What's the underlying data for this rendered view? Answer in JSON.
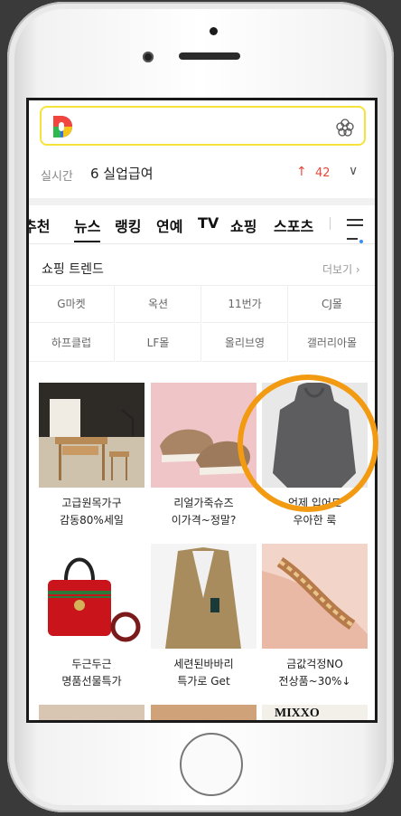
{
  "search": {
    "placeholder": ""
  },
  "realtime": {
    "label": "실시간",
    "keyword": "6 실업급여",
    "arrow": "↑",
    "count": "42",
    "chevron": "∨"
  },
  "tabs": [
    {
      "label": "추천"
    },
    {
      "label": "뉴스"
    },
    {
      "label": "랭킹"
    },
    {
      "label": "연예"
    },
    {
      "label": "TV"
    },
    {
      "label": "쇼핑"
    },
    {
      "label": "스포츠"
    }
  ],
  "shopping": {
    "title": "쇼핑 트렌드",
    "more": "더보기 ›",
    "stores": [
      "G마켓",
      "옥션",
      "11번가",
      "CJ몰",
      "하프클럽",
      "LF몰",
      "올리브영",
      "갤러리아몰"
    ],
    "products": [
      {
        "line1": "고급원목가구",
        "line2": "감동80%세일"
      },
      {
        "line1": "리얼가죽슈즈",
        "line2": "이가격~정말?"
      },
      {
        "line1": "언제 입어도",
        "line2": "우아한 룩"
      },
      {
        "line1": "두근두근",
        "line2": "명품선물특가"
      },
      {
        "line1": "세련된바바리",
        "line2": "특가로 Get"
      },
      {
        "line1": "금값걱정NO",
        "line2": "전상품~30%↓"
      }
    ],
    "partial_label": "MIXXO"
  },
  "colors": {
    "accent": "#f5e33a",
    "highlight_ring": "#f29a12",
    "up_arrow": "#e8473b"
  }
}
